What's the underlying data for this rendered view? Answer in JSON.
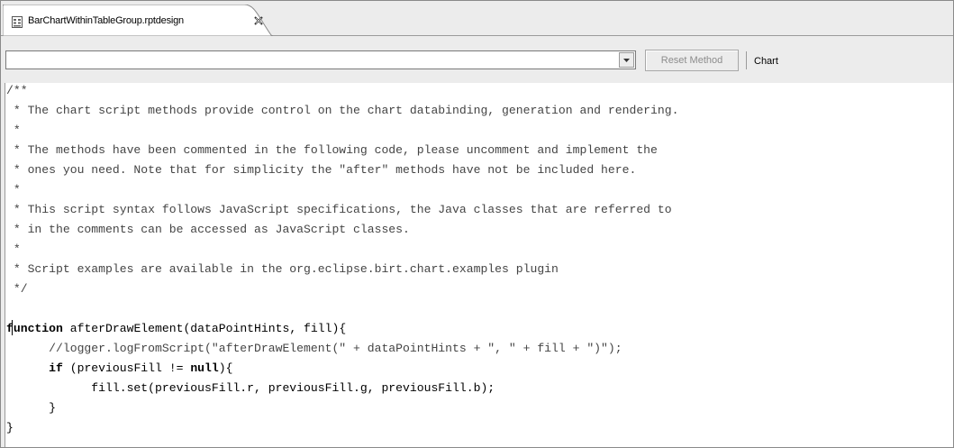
{
  "tab": {
    "title": "BarChartWithinTableGroup.rptdesign",
    "icon": "report-design-icon",
    "close_icon": "close-icon"
  },
  "toolbar": {
    "method_value": "",
    "reset_label": "Reset Method",
    "context_label": "Chart"
  },
  "editor": {
    "lines": [
      "/**",
      " * The chart script methods provide control on the chart databinding, generation and rendering.",
      " *",
      " * The methods have been commented in the following code, please uncomment and implement the",
      " * ones you need. Note that for simplicity the \"after\" methods have not be included here.",
      " *",
      " * This script syntax follows JavaScript specifications, the Java classes that are referred to",
      " * in the comments can be accessed as JavaScript classes.",
      " *",
      " * Script examples are available in the org.eclipse.birt.chart.examples plugin",
      " */",
      "",
      "",
      "function afterDrawElement(dataPointHints, fill){",
      "      //logger.logFromScript(\"afterDrawElement(\" + dataPointHints + \", \" + fill + \")\");",
      "      if (previousFill != null){",
      "            fill.set(previousFill.r, previousFill.g, previousFill.b);",
      "      }",
      "}"
    ]
  }
}
